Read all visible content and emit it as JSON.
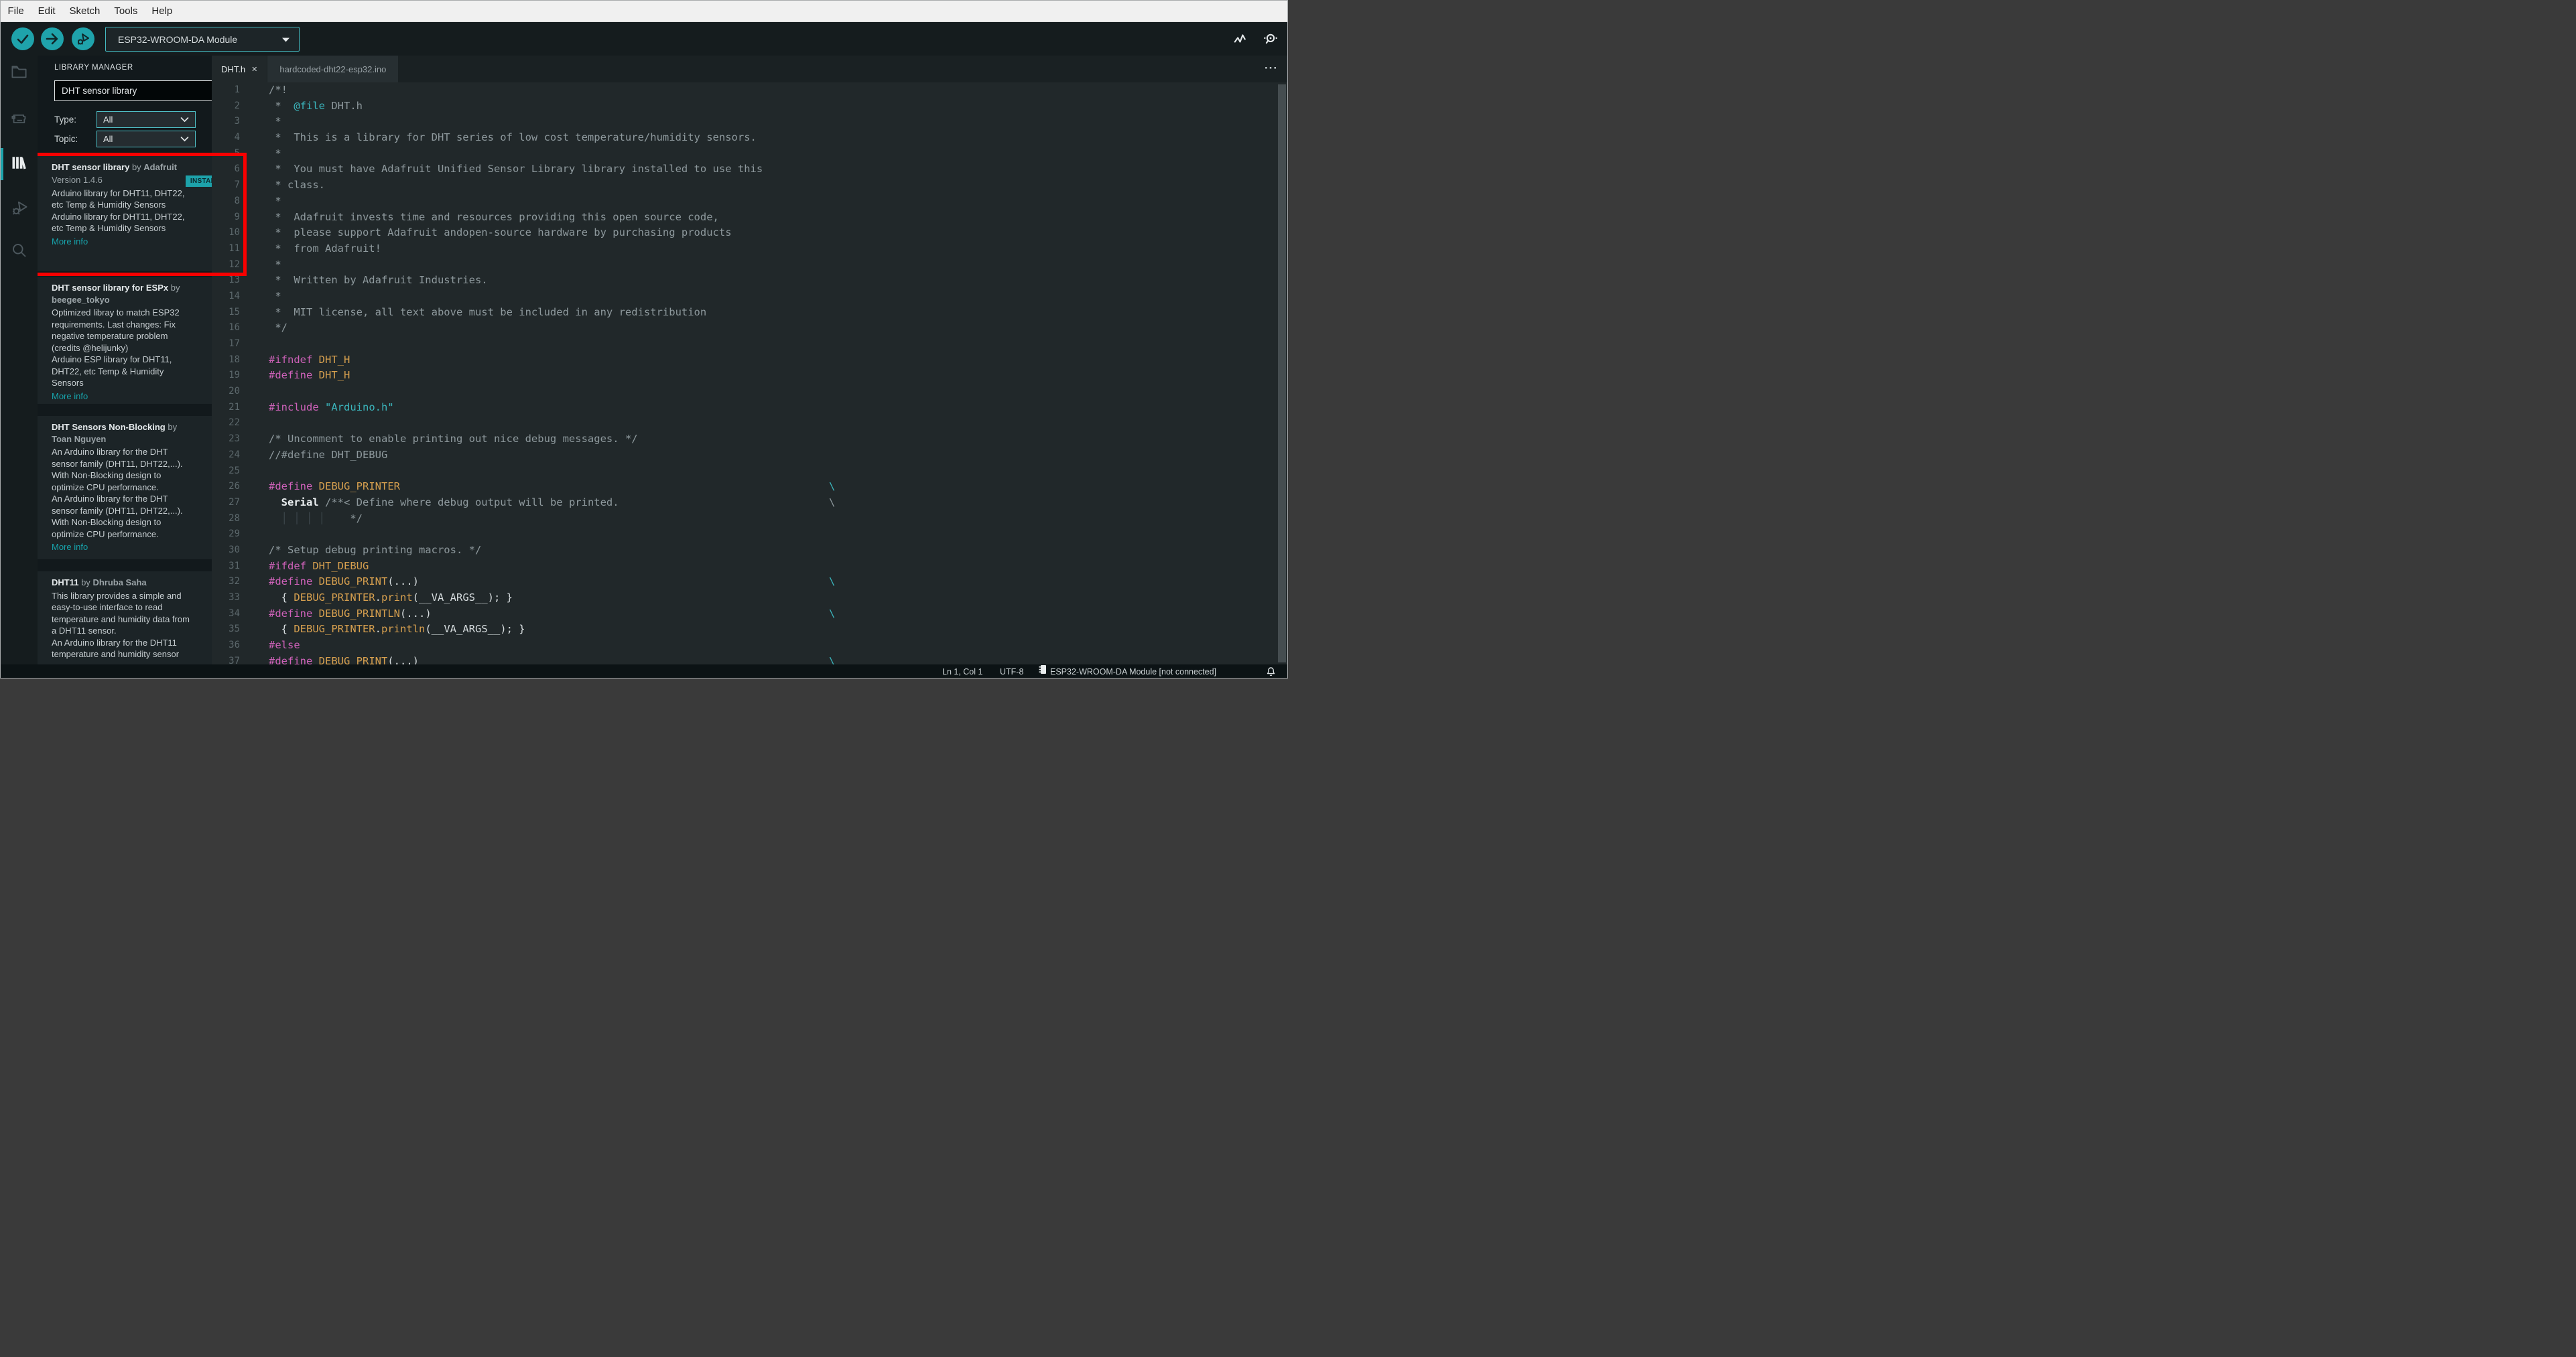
{
  "menu_bar": {
    "items": [
      "File",
      "Edit",
      "Sketch",
      "Tools",
      "Help"
    ]
  },
  "toolbar": {
    "board_selector": "ESP32-WROOM-DA Module"
  },
  "activity_bar": {
    "items": [
      {
        "id": "sketchbook",
        "icon": "folder",
        "active": false
      },
      {
        "id": "boards-manager",
        "icon": "chip",
        "active": false
      },
      {
        "id": "library-manager",
        "icon": "books",
        "active": true
      },
      {
        "id": "debug",
        "icon": "bug",
        "active": false
      },
      {
        "id": "search",
        "icon": "search",
        "active": false
      }
    ]
  },
  "library_manager": {
    "title": "LIBRARY MANAGER",
    "search_value": "DHT sensor library",
    "filters": [
      {
        "label": "Type:",
        "value": "All"
      },
      {
        "label": "Topic:",
        "value": "All"
      }
    ],
    "items": [
      {
        "title_parts": [
          [
            "DHT sensor library",
            "tw"
          ],
          [
            " by ",
            "tb"
          ],
          [
            "Adafruit",
            "ta"
          ]
        ],
        "version": "Version 1.4.6",
        "badge": "INSTALLED",
        "desc_lines": [
          "Arduino library for DHT11, DHT22,",
          "etc Temp & Humidity Sensors",
          "Arduino library for DHT11, DHT22,",
          "etc Temp & Humidity Sensors"
        ],
        "more": "More info",
        "highlighted": true
      },
      {
        "title_parts": [
          [
            "DHT sensor library for ESPx",
            "tw"
          ],
          [
            " by",
            "tb"
          ],
          [
            "\nbeegee_tokyo",
            "ta"
          ]
        ],
        "desc_lines": [
          "Optimized libray to match ESP32",
          "requirements. Last changes: Fix",
          "negative temperature problem",
          "(credits @helijunky)",
          "Arduino ESP library for DHT11,",
          "DHT22, etc Temp & Humidity",
          "Sensors"
        ],
        "more": "More info"
      },
      {
        "title_parts": [
          [
            "DHT Sensors Non-Blocking",
            "tw"
          ],
          [
            " by",
            "tb"
          ],
          [
            "\nToan Nguyen",
            "ta"
          ]
        ],
        "desc_lines": [
          "An Arduino library for the DHT",
          "sensor family (DHT11, DHT22,...).",
          "With Non-Blocking design to",
          "optimize CPU performance.",
          "An Arduino library for the DHT",
          "sensor family (DHT11, DHT22,...).",
          "With Non-Blocking design to",
          "optimize CPU performance."
        ],
        "more": "More info"
      },
      {
        "title_parts": [
          [
            "DHT11",
            "tw"
          ],
          [
            " by ",
            "tb"
          ],
          [
            "Dhruba Saha",
            "ta"
          ]
        ],
        "desc_lines": [
          "This library provides a simple and",
          "easy-to-use interface to read",
          "temperature and humidity data from",
          "a DHT11 sensor.",
          "An Arduino library for the DHT11",
          "temperature and humidity sensor"
        ]
      }
    ]
  },
  "tabs": {
    "close_glyph": "✕",
    "more_glyph": "···",
    "items": [
      {
        "label": "DHT.h",
        "active": true
      },
      {
        "label": "hardcoded-dht22-esp32.ino",
        "active": false
      }
    ]
  },
  "editor": {
    "lines": [
      {
        "n": 1,
        "s": [
          [
            "/*!",
            "c"
          ]
        ]
      },
      {
        "n": 2,
        "s": [
          [
            " *  ",
            "c"
          ],
          [
            "@file",
            "s"
          ],
          [
            " DHT.h",
            "c"
          ]
        ]
      },
      {
        "n": 3,
        "s": [
          [
            " *",
            "c"
          ]
        ]
      },
      {
        "n": 4,
        "s": [
          [
            " *  This is a library for DHT series of low cost temperature/humidity sensors.",
            "c"
          ]
        ]
      },
      {
        "n": 5,
        "s": [
          [
            " *",
            "c"
          ]
        ]
      },
      {
        "n": 6,
        "s": [
          [
            " *  You must have Adafruit Unified Sensor Library library installed to use this",
            "c"
          ]
        ]
      },
      {
        "n": 7,
        "s": [
          [
            " * class.",
            "c"
          ]
        ]
      },
      {
        "n": 8,
        "s": [
          [
            " *",
            "c"
          ]
        ]
      },
      {
        "n": 9,
        "s": [
          [
            " *  Adafruit invests time and resources providing this open source code,",
            "c"
          ]
        ]
      },
      {
        "n": 10,
        "s": [
          [
            " *  please support Adafruit andopen-source hardware by purchasing products",
            "c"
          ]
        ]
      },
      {
        "n": 11,
        "s": [
          [
            " *  from Adafruit!",
            "c"
          ]
        ]
      },
      {
        "n": 12,
        "s": [
          [
            " *",
            "c"
          ]
        ]
      },
      {
        "n": 13,
        "s": [
          [
            " *  Written by Adafruit Industries.",
            "c"
          ]
        ]
      },
      {
        "n": 14,
        "s": [
          [
            " *",
            "c"
          ]
        ]
      },
      {
        "n": 15,
        "s": [
          [
            " *  MIT license, all text above must be included in any redistribution",
            "c"
          ]
        ]
      },
      {
        "n": 16,
        "s": [
          [
            " */",
            "c"
          ]
        ]
      },
      {
        "n": 17,
        "s": []
      },
      {
        "n": 18,
        "s": [
          [
            "#ifndef",
            "p"
          ],
          [
            " ",
            "d"
          ],
          [
            "DHT_H",
            "o"
          ]
        ]
      },
      {
        "n": 19,
        "s": [
          [
            "#define",
            "p"
          ],
          [
            " ",
            "d"
          ],
          [
            "DHT_H",
            "o"
          ]
        ]
      },
      {
        "n": 20,
        "s": []
      },
      {
        "n": 21,
        "s": [
          [
            "#include",
            "p"
          ],
          [
            " ",
            "d"
          ],
          [
            "\"Arduino.h\"",
            "s"
          ]
        ]
      },
      {
        "n": 22,
        "s": []
      },
      {
        "n": 23,
        "s": [
          [
            "/* Uncomment to enable printing out nice debug messages. */",
            "c"
          ]
        ]
      },
      {
        "n": 24,
        "s": [
          [
            "//#define DHT_DEBUG",
            "c"
          ]
        ]
      },
      {
        "n": 25,
        "s": []
      },
      {
        "n": 26,
        "s": [
          [
            "#define",
            "p"
          ],
          [
            " ",
            "d"
          ],
          [
            "DEBUG_PRINTER",
            "o"
          ],
          [
            "\\",
            "bs"
          ]
        ]
      },
      {
        "n": 27,
        "s": [
          [
            "  ",
            "d"
          ],
          [
            "Serial",
            "sb"
          ],
          [
            " /**< Define where debug output will be printed.",
            "c"
          ],
          [
            "\\",
            "bsg"
          ]
        ]
      },
      {
        "n": 28,
        "s": [
          [
            "  ",
            "d"
          ],
          [
            "│ │ │ │",
            "g"
          ],
          [
            "    */",
            "c"
          ]
        ]
      },
      {
        "n": 29,
        "s": []
      },
      {
        "n": 30,
        "s": [
          [
            "/* Setup debug printing macros. */",
            "c"
          ]
        ]
      },
      {
        "n": 31,
        "s": [
          [
            "#ifdef",
            "p"
          ],
          [
            " ",
            "d"
          ],
          [
            "DHT_DEBUG",
            "o"
          ]
        ]
      },
      {
        "n": 32,
        "s": [
          [
            "#define",
            "p"
          ],
          [
            " ",
            "d"
          ],
          [
            "DEBUG_PRINT",
            "o"
          ],
          [
            "(...)",
            "d"
          ],
          [
            "\\",
            "bs"
          ]
        ]
      },
      {
        "n": 33,
        "s": [
          [
            "  { ",
            "d"
          ],
          [
            "DEBUG_PRINTER",
            "o"
          ],
          [
            ".",
            "d"
          ],
          [
            "print",
            "o"
          ],
          [
            "(__VA_ARGS__); }",
            "d"
          ]
        ]
      },
      {
        "n": 34,
        "s": [
          [
            "#define",
            "p"
          ],
          [
            " ",
            "d"
          ],
          [
            "DEBUG_PRINTLN",
            "o"
          ],
          [
            "(...)",
            "d"
          ],
          [
            "\\",
            "bs"
          ]
        ]
      },
      {
        "n": 35,
        "s": [
          [
            "  { ",
            "d"
          ],
          [
            "DEBUG_PRINTER",
            "o"
          ],
          [
            ".",
            "d"
          ],
          [
            "println",
            "o"
          ],
          [
            "(__VA_ARGS__); }",
            "d"
          ]
        ]
      },
      {
        "n": 36,
        "s": [
          [
            "#else",
            "p"
          ]
        ]
      },
      {
        "n": 37,
        "s": [
          [
            "#define",
            "p"
          ],
          [
            " ",
            "d"
          ],
          [
            "DEBUG_PRINT",
            "o"
          ],
          [
            "(...)",
            "d"
          ],
          [
            "\\",
            "bs"
          ]
        ]
      }
    ]
  },
  "status_bar": {
    "position": "Ln 1, Col 1",
    "encoding": "UTF-8",
    "board": "ESP32-WROOM-DA Module [not connected]"
  },
  "colors": {
    "accent": "#1ea3ab",
    "annotation_red": "#f90000",
    "code_comment": "#8e999d",
    "code_default": "#d6dcde",
    "code_preproc": "#cf62ba",
    "code_macro": "#d7a04f",
    "code_string": "#3bb6bd"
  }
}
